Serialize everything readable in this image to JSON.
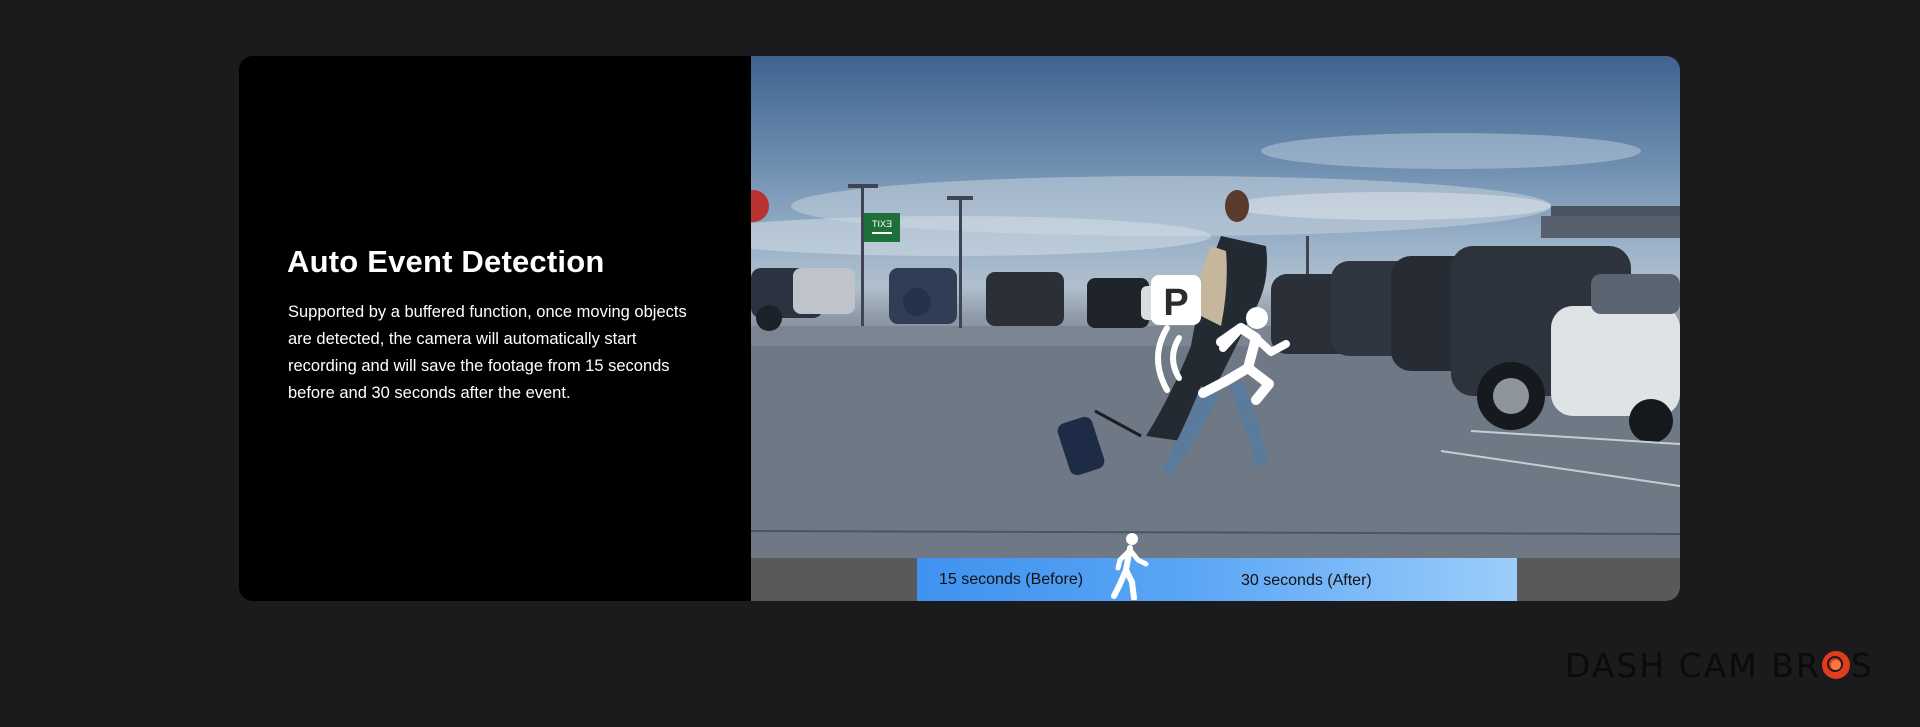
{
  "feature": {
    "title": "Auto Event Detection",
    "description": "Supported by a buffered function, once moving objects are detected, the camera will automatically start recording and will save the footage from 15 seconds before and 30 seconds after the event."
  },
  "overlay": {
    "parking_badge": "P",
    "motion_icon": "running-person-motion-icon"
  },
  "timeline": {
    "before_label": "15 seconds (Before)",
    "after_label": "30 seconds (After)",
    "marker_icon": "walking-person-icon"
  },
  "scene": {
    "exit_sign": "EXIT"
  },
  "brand": {
    "logo_text_left": "DASH CAM BR",
    "logo_text_right": "S",
    "accent_color": "#e23c1e"
  },
  "colors": {
    "background": "#1b1b1e",
    "timeline_bar_start": "#3f92ef",
    "timeline_bar_end": "#9ccdfb"
  }
}
